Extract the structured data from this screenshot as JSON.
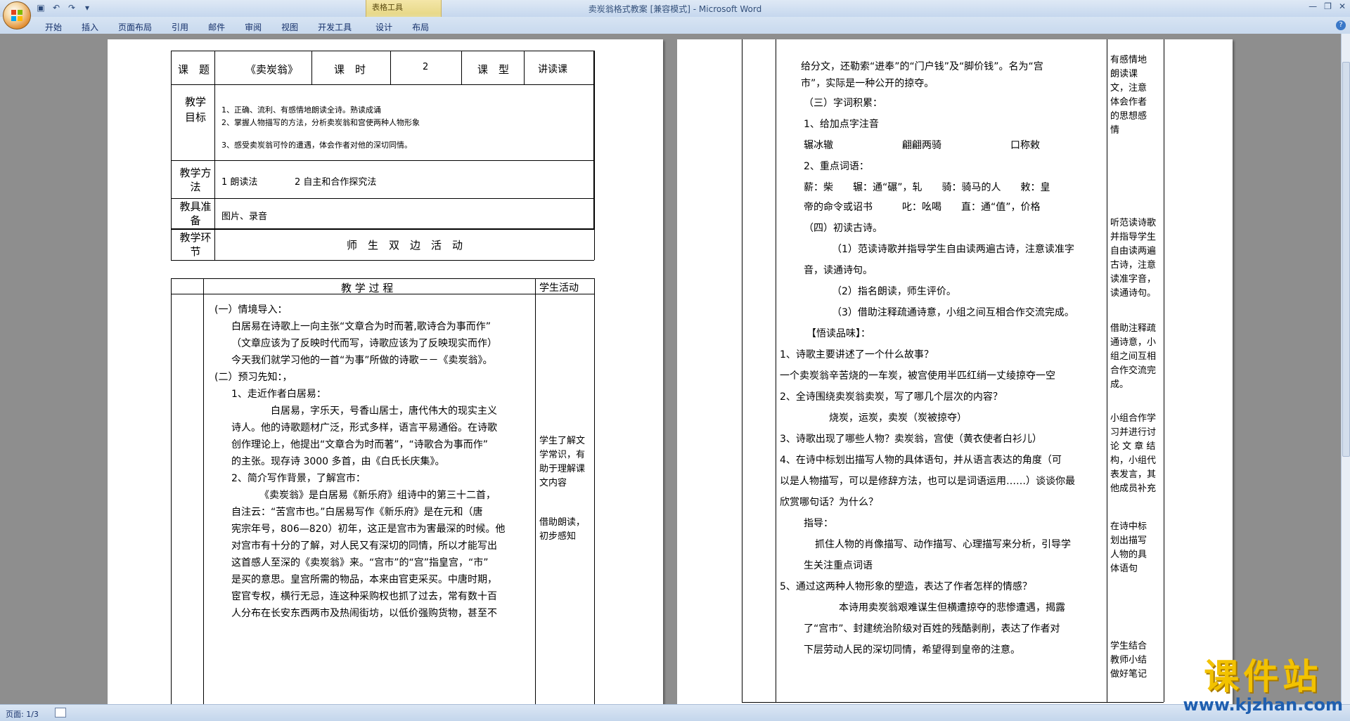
{
  "window": {
    "title": "卖炭翁格式教案 [兼容模式] - Microsoft Word",
    "context_tab_group": "表格工具"
  },
  "ribbon": {
    "tabs": [
      "开始",
      "插入",
      "页面布局",
      "引用",
      "邮件",
      "审阅",
      "视图",
      "开发工具",
      "设计",
      "布局"
    ]
  },
  "status": {
    "page": "页面: 1/3"
  },
  "page1": {
    "header_row": {
      "topic_label": "课　题",
      "topic_value": "《卖炭翁》",
      "hours_label": "课　时",
      "hours_value": "2",
      "type_label": "课　型",
      "type_value": "讲读课"
    },
    "goals": {
      "label": "教学目标",
      "lines": [
        "1、正确、流利、有感情地朗读全诗。熟读成诵",
        "2、掌握人物描写的方法，分析卖炭翁和宫使两种人物形象",
        "3、感受卖炭翁可怜的遭遇，体会作者对他的深切同情。"
      ]
    },
    "method": {
      "label": "教学方法",
      "value1": "1 朗读法",
      "value2": "2 自主和合作探究法"
    },
    "tools": {
      "label": "教具准备",
      "value": "图片、录音"
    },
    "segment": {
      "label": "教学环节",
      "value": "师　生　双　边　活　动"
    },
    "process_header": {
      "col1": "教 学 过 程",
      "col2": "学生活动"
    },
    "process_lines": [
      "(一）情境导入：",
      "白居易在诗歌上一向主张“文章合为时而著,歌诗合为事而作”",
      "（文章应该为了反映时代而写，诗歌应该为了反映现实而作）",
      "今天我们就学习他的一首“为事”所做的诗歌－－《卖炭翁》。",
      "(二）预习先知：，",
      "1、走近作者白居易：",
      "白居易，字乐天，号香山居士，唐代伟大的现实主义",
      "诗人。他的诗歌题材广泛，形式多样，语言平易通俗。在诗歌",
      "创作理论上，他提出“文章合为时而著”，“诗歌合为事而作”",
      "的主张。现存诗 3000 多首，由《白氏长庆集》。",
      "2、简介写作背景，了解宫市：",
      "《卖炭翁》是白居易《新乐府》组诗中的第三十二首，",
      "自注云：“苦宫市也。”白居易写作《新乐府》是在元和（唐",
      "宪宗年号，806—820）初年，这正是宫市为害最深的时候。他",
      "对宫市有十分的了解，对人民又有深切的同情，所以才能写出",
      "这首感人至深的《卖炭翁》来。“宫市”的“宫”指皇宫，“市”",
      "是买的意思。皇宫所需的物品，本来由官吏采买。中唐时期，",
      "宦官专权，横行无忌，连这种采购权也抓了过去，常有数十百",
      "人分布在长安东西两市及热闹街坊，以低价强购货物，甚至不"
    ],
    "student_notes": [
      "学生了解文",
      "学常识，有",
      "助于理解课",
      "文内容",
      "借助朗读，",
      "初步感知"
    ]
  },
  "page2": {
    "lines": [
      "给分文，还勒索“进奉”的“门户钱”及“脚价钱”。名为“宫",
      "市”，实际是一种公开的掠夺。",
      "（三）字词积累：",
      "1、给加点字注音",
      "辗冰辙",
      "翩翩两骑",
      "口称敕",
      "2、重点词语：",
      "薪：柴　　辗：通“碾”，轧　　骑：骑马的人　　敕：皇",
      "帝的命令或诏书　　　叱：吆喝　　直：通“值”，价格",
      "（四）初读古诗。",
      "（1）范读诗歌并指导学生自由读两遍古诗，注意读准字",
      "音，读通诗句。",
      "（2）指名朗读，师生评价。",
      "（3）借助注释疏通诗意，小组之间互相合作交流完成。",
      "【悟读品味】：",
      "1、诗歌主要讲述了一个什么故事？",
      "一个卖炭翁辛苦烧的一车炭，被宫使用半匹红绡一丈绫掠夺一空",
      "2、全诗围绕卖炭翁卖炭，写了哪几个层次的内容？",
      "烧炭，运炭，卖炭（炭被掠夺）",
      "3、诗歌出现了哪些人物？卖炭翁，宫使（黄衣使者白衫儿）",
      "4、在诗中标划出描写人物的具体语句，并从语言表达的角度（可",
      "以是人物描写，可以是修辞方法，也可以是词语运用……）谈谈你最",
      "欣赏哪句话？为什么？",
      "指导：",
      "抓住人物的肖像描写、动作描写、心理描写来分析，引导学",
      "生关注重点词语",
      "5、通过这两种人物形象的塑造，表达了作者怎样的情感？",
      "本诗用卖炭翁艰难谋生但横遭掠夺的悲惨遭遇，揭露",
      "了“宫市”、封建统治阶级对百姓的残酷剥削，表达了作者对",
      "下层劳动人民的深切同情，希望得到皇帝的注意。"
    ],
    "side_notes": [
      "有感情地",
      "朗读课",
      "文，注意",
      "体会作者",
      "的思想感",
      "情",
      "听范读诗歌",
      "并指导学生",
      "自由读两遍",
      "古诗，注意",
      "读准字音，",
      "读通诗句。",
      "借助注释疏",
      "通诗意，小",
      "组之间互相",
      "合作交流完",
      "成。",
      "小组合作学",
      "习并进行讨",
      "论 文 章 结",
      "构，小组代",
      "表发言，其",
      "他成员补充",
      "在诗中标",
      "划出描写",
      "人物的具",
      "体语句",
      "学生结合",
      "教师小结",
      "做好笔记"
    ]
  },
  "watermark": {
    "text": "课件站",
    "url": "www.kjzhan.com"
  }
}
